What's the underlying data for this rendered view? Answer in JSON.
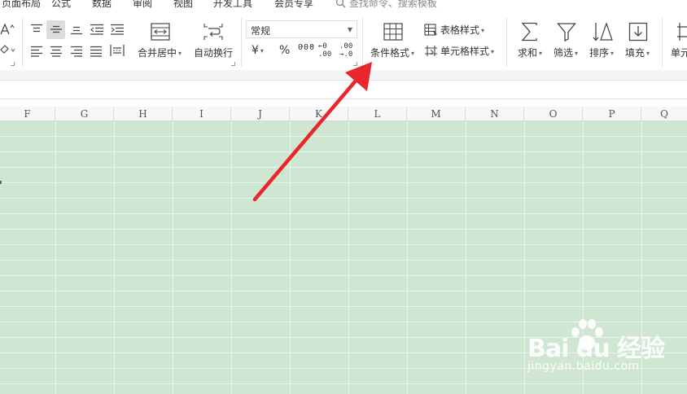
{
  "menubar": {
    "items": [
      "页面布局",
      "公式",
      "数据",
      "审阅",
      "视图",
      "开发工具",
      "会员专享"
    ],
    "search_placeholder": "查找命令、搜索模板"
  },
  "ribbon": {
    "merge_center_label": "合并居中",
    "auto_wrap_label": "自动换行",
    "number_format": {
      "selected": "常规"
    },
    "currency_symbol": "¥",
    "percent_symbol": "%",
    "thousands_symbol": "000",
    "decrease_decimal_symbol": ".00",
    "increase_decimal_symbol": ".0",
    "conditional_format_label": "条件格式",
    "table_style_label": "表格样式",
    "cell_style_label": "单元格样式",
    "sum_label": "求和",
    "filter_label": "筛选",
    "sort_label": "排序",
    "fill_label": "填充",
    "cell_label": "单元"
  },
  "column_headers": [
    "F",
    "G",
    "H",
    "I",
    "J",
    "K",
    "L",
    "M",
    "N",
    "O",
    "P",
    "Q"
  ],
  "watermark": {
    "brand": "Bai du 经验",
    "url": "jingyan.baidu.com"
  },
  "colors": {
    "sheet_fill": "#cfe6d2",
    "arrow": "#e8262b",
    "menu_text": "#333333"
  },
  "icons": [
    "font-increase-icon",
    "clear-format-icon",
    "align-top-icon",
    "align-middle-icon",
    "align-bottom-icon",
    "indent-decrease-icon",
    "indent-increase-icon",
    "align-left-icon",
    "align-center-icon",
    "align-right-icon",
    "justify-icon",
    "distributed-icon",
    "merge-center-icon",
    "auto-wrap-icon",
    "conditional-format-icon",
    "table-style-icon",
    "cell-style-icon",
    "sum-icon",
    "filter-icon",
    "sort-icon",
    "fill-icon",
    "cell-icon",
    "search-icon"
  ]
}
